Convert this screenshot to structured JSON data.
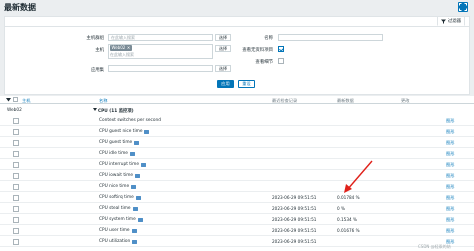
{
  "page": {
    "title": "最新数据"
  },
  "filter": {
    "tab_label": "过滤器",
    "host_group_label": "主机群组",
    "host_group_placeholder": "在此输入搜索",
    "host_label": "主机",
    "host_chip": "Web02",
    "host_placeholder": "在此输入搜索",
    "app_label": "应用集",
    "select_label": "选择",
    "name_label": "名称",
    "show_no_data_label": "查看无资料项目",
    "show_details_label": "查看细节",
    "apply_label": "应用",
    "reset_label": "重设"
  },
  "table": {
    "headers": {
      "host": "主机",
      "name": "名称",
      "last_check": "最近检查记录",
      "last_value": "最新数据",
      "change": "更改"
    },
    "group": {
      "host": "Web02",
      "name": "CPU (11 监控项)"
    },
    "rows": [
      {
        "name": "Context switches per second",
        "flag": false,
        "time": "",
        "value": "",
        "graph": "图形"
      },
      {
        "name": "CPU guest nice time",
        "flag": true,
        "time": "",
        "value": "",
        "graph": "图形"
      },
      {
        "name": "CPU guest time",
        "flag": true,
        "time": "",
        "value": "",
        "graph": "图形"
      },
      {
        "name": "CPU idle time",
        "flag": true,
        "time": "",
        "value": "",
        "graph": "图形"
      },
      {
        "name": "CPU interrupt time",
        "flag": true,
        "time": "",
        "value": "",
        "graph": "图形"
      },
      {
        "name": "CPU iowait time",
        "flag": true,
        "time": "",
        "value": "",
        "graph": "图形"
      },
      {
        "name": "CPU nice time",
        "flag": true,
        "time": "",
        "value": "",
        "graph": "图形"
      },
      {
        "name": "CPU softirq time",
        "flag": true,
        "time": "2023-06-29 09:51:51",
        "value": "0.01784 %",
        "graph": "图形"
      },
      {
        "name": "CPU steal time",
        "flag": true,
        "time": "2023-06-29 09:51:51",
        "value": "0 %",
        "graph": "图形"
      },
      {
        "name": "CPU system time",
        "flag": true,
        "time": "2023-06-29 09:51:51",
        "value": "0.1534 %",
        "graph": "图形"
      },
      {
        "name": "CPU user time",
        "flag": true,
        "time": "2023-06-29 09:51:51",
        "value": "0.01676 %",
        "graph": "图形"
      },
      {
        "name": "CPU utilization",
        "flag": true,
        "time": "2023-06-29 09:51:51",
        "value": "",
        "graph": "图形"
      }
    ]
  },
  "watermark": "CSDN @轻乘的纳"
}
